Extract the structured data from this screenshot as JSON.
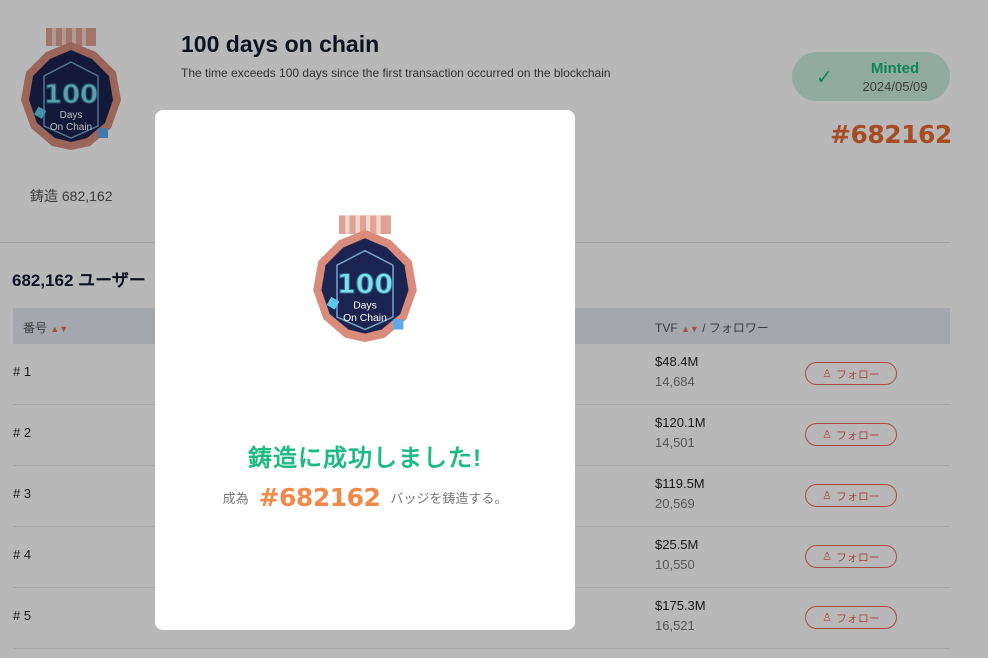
{
  "badge": {
    "name": "100 days on chain",
    "description": "The time exceeds 100 days since the first transaction occurred on the blockchain",
    "art_number": "100",
    "art_line1": "Days",
    "art_line2": "On Chain",
    "mint_count": "鋳造 682,162",
    "status": "Minted",
    "status_date": "2024/05/09",
    "serial": "#682162"
  },
  "users": {
    "heading": "682,162 ユーザー",
    "columns": {
      "number": "番号",
      "tvf": "TVF",
      "followers": "/ フォロワー"
    },
    "follow_label": "フォロー",
    "rows": [
      {
        "num": "# 1",
        "tvf": "$48.4M",
        "followers": "14,684"
      },
      {
        "num": "# 2",
        "tvf": "$120.1M",
        "followers": "14,501"
      },
      {
        "num": "# 3",
        "tvf": "$119.5M",
        "followers": "20,569"
      },
      {
        "num": "# 4",
        "tvf": "$25.5M",
        "followers": "10,550"
      },
      {
        "num": "# 5",
        "tvf": "$175.3M",
        "followers": "16,521"
      }
    ]
  },
  "modal": {
    "title": "鋳造に成功しました!",
    "prefix": "成為",
    "serial": "#682162",
    "suffix": "バッジを鋳造する。"
  },
  "colors": {
    "accent_green": "#1dbb82",
    "serial_orange": "#f08a4b",
    "follow_red": "#e86a5e",
    "badge_navy": "#1b2450",
    "badge_copper": "#d98c7c"
  },
  "icons": {
    "check": "check-icon",
    "sort": "sort-icon",
    "follow": "user-plus-icon"
  }
}
